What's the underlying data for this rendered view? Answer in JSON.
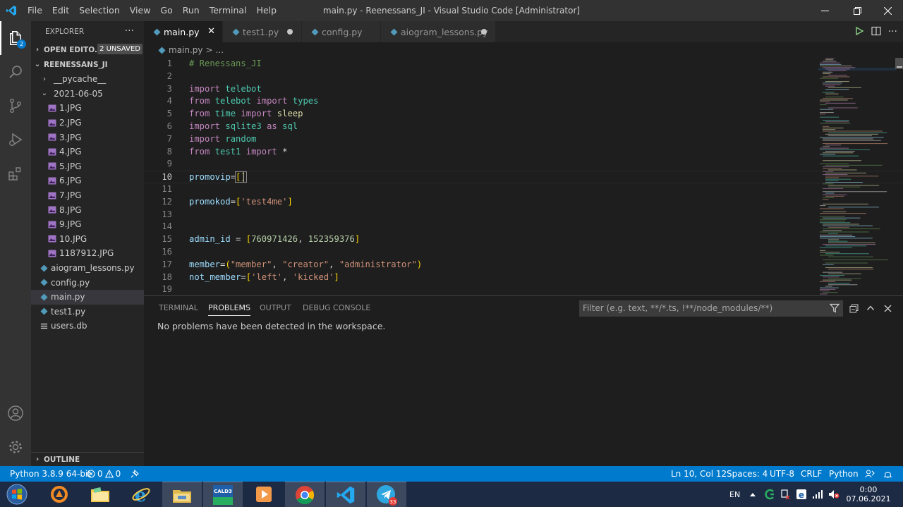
{
  "titlebar": {
    "menu": [
      "File",
      "Edit",
      "Selection",
      "View",
      "Go",
      "Run",
      "Terminal",
      "Help"
    ],
    "title": "main.py - Reenessans_JI - Visual Studio Code [Administrator]",
    "controls": [
      "minimize-icon",
      "restore-icon",
      "close-icon"
    ]
  },
  "activitybar": {
    "items": [
      "explorer-icon",
      "search-icon",
      "source-control-icon",
      "run-debug-icon",
      "extensions-icon"
    ],
    "explorer_badge": "2",
    "bottom": [
      "account-icon",
      "settings-gear-icon"
    ]
  },
  "sidebar": {
    "header": "EXPLORER",
    "more": "···",
    "open_editors": {
      "label": "OPEN EDITO...",
      "badge": "2 UNSAVED"
    },
    "folder": "REENESSANS_JI",
    "tree": [
      {
        "label": "__pycache__",
        "type": "folder",
        "expanded": false
      },
      {
        "label": "2021-06-05",
        "type": "folder",
        "expanded": true
      },
      {
        "label": "1.JPG",
        "type": "image"
      },
      {
        "label": "2.JPG",
        "type": "image"
      },
      {
        "label": "3.JPG",
        "type": "image"
      },
      {
        "label": "4.JPG",
        "type": "image"
      },
      {
        "label": "5.JPG",
        "type": "image"
      },
      {
        "label": "6.JPG",
        "type": "image"
      },
      {
        "label": "7.JPG",
        "type": "image"
      },
      {
        "label": "8.JPG",
        "type": "image"
      },
      {
        "label": "9.JPG",
        "type": "image"
      },
      {
        "label": "10.JPG",
        "type": "image"
      },
      {
        "label": "1187912.JPG",
        "type": "image"
      },
      {
        "label": "aiogram_lessons.py",
        "type": "python"
      },
      {
        "label": "config.py",
        "type": "python"
      },
      {
        "label": "main.py",
        "type": "python",
        "selected": true
      },
      {
        "label": "test1.py",
        "type": "python"
      },
      {
        "label": "users.db",
        "type": "db"
      }
    ],
    "outline": "OUTLINE"
  },
  "tabs": [
    {
      "label": "main.py",
      "active": true,
      "state": "close"
    },
    {
      "label": "test1.py",
      "active": false,
      "state": "dirty"
    },
    {
      "label": "config.py",
      "active": false,
      "state": "none"
    },
    {
      "label": "aiogram_lessons.py",
      "active": false,
      "state": "dirty"
    }
  ],
  "breadcrumb": {
    "file": "main.py",
    "sep": ">",
    "rest": "..."
  },
  "editor": {
    "current_line": 10,
    "lines": [
      {
        "n": "1",
        "tokens": [
          [
            "cm",
            "# Renessans_JI"
          ]
        ]
      },
      {
        "n": "2",
        "tokens": []
      },
      {
        "n": "3",
        "tokens": [
          [
            "kw",
            "import"
          ],
          [
            "t",
            " "
          ],
          [
            "mod",
            "telebot"
          ]
        ]
      },
      {
        "n": "4",
        "tokens": [
          [
            "kw",
            "from"
          ],
          [
            "t",
            " "
          ],
          [
            "mod",
            "telebot"
          ],
          [
            "t",
            " "
          ],
          [
            "kw",
            "import"
          ],
          [
            "t",
            " "
          ],
          [
            "mod",
            "types"
          ]
        ]
      },
      {
        "n": "5",
        "tokens": [
          [
            "kw",
            "from"
          ],
          [
            "t",
            " "
          ],
          [
            "mod",
            "time"
          ],
          [
            "t",
            " "
          ],
          [
            "kw",
            "import"
          ],
          [
            "t",
            " "
          ],
          [
            "fn",
            "sleep"
          ]
        ]
      },
      {
        "n": "6",
        "tokens": [
          [
            "kw",
            "import"
          ],
          [
            "t",
            " "
          ],
          [
            "mod",
            "sqlite3"
          ],
          [
            "t",
            " "
          ],
          [
            "kw",
            "as"
          ],
          [
            "t",
            " "
          ],
          [
            "mod",
            "sql"
          ]
        ]
      },
      {
        "n": "7",
        "tokens": [
          [
            "kw",
            "import"
          ],
          [
            "t",
            " "
          ],
          [
            "mod",
            "random"
          ]
        ]
      },
      {
        "n": "8",
        "tokens": [
          [
            "kw",
            "from"
          ],
          [
            "t",
            " "
          ],
          [
            "mod",
            "test1"
          ],
          [
            "t",
            " "
          ],
          [
            "kw",
            "import"
          ],
          [
            "t",
            " *"
          ]
        ]
      },
      {
        "n": "9",
        "tokens": []
      },
      {
        "n": "10",
        "tokens": [
          [
            "var",
            "promovip"
          ],
          [
            "t",
            "="
          ],
          [
            "hl",
            "[]"
          ]
        ]
      },
      {
        "n": "11",
        "tokens": []
      },
      {
        "n": "12",
        "tokens": [
          [
            "var",
            "promokod"
          ],
          [
            "t",
            "="
          ],
          [
            "br",
            "["
          ],
          [
            "str",
            "'test4me'"
          ],
          [
            "br",
            "]"
          ]
        ]
      },
      {
        "n": "13",
        "tokens": []
      },
      {
        "n": "14",
        "tokens": []
      },
      {
        "n": "15",
        "tokens": [
          [
            "var",
            "admin_id"
          ],
          [
            "t",
            " = "
          ],
          [
            "br",
            "["
          ],
          [
            "num",
            "760971426"
          ],
          [
            "t",
            ", "
          ],
          [
            "num",
            "152359376"
          ],
          [
            "br",
            "]"
          ]
        ]
      },
      {
        "n": "16",
        "tokens": []
      },
      {
        "n": "17",
        "tokens": [
          [
            "var",
            "member"
          ],
          [
            "t",
            "="
          ],
          [
            "br",
            "("
          ],
          [
            "str",
            "\"member\""
          ],
          [
            "t",
            ", "
          ],
          [
            "str",
            "\"creator\""
          ],
          [
            "t",
            ", "
          ],
          [
            "str",
            "\"administrator\""
          ],
          [
            "br",
            ")"
          ]
        ]
      },
      {
        "n": "18",
        "tokens": [
          [
            "var",
            "not_member"
          ],
          [
            "t",
            "="
          ],
          [
            "br",
            "["
          ],
          [
            "str",
            "'left'"
          ],
          [
            "t",
            ", "
          ],
          [
            "str",
            "'kicked'"
          ],
          [
            "br",
            "]"
          ]
        ]
      },
      {
        "n": "19",
        "tokens": []
      }
    ]
  },
  "panel": {
    "tabs": [
      "TERMINAL",
      "PROBLEMS",
      "OUTPUT",
      "DEBUG CONSOLE"
    ],
    "active_tab": "PROBLEMS",
    "filter_placeholder": "Filter (e.g. text, **/*.ts, !**/node_modules/**)",
    "message": "No problems have been detected in the workspace."
  },
  "statusbar": {
    "python": "Python 3.8.9 64-bit",
    "errors": "0",
    "warnings": "0",
    "position": "Ln 10, Col 12",
    "spaces": "Spaces: 4",
    "encoding": "UTF-8",
    "eol": "CRLF",
    "language": "Python"
  },
  "taskbar": {
    "apps": [
      "windows-start-icon",
      "avast-icon",
      "file-explorer-folder-icon",
      "internet-explorer-icon",
      "file-explorer-icon",
      "cald3-app-icon",
      "media-player-icon",
      "chrome-icon",
      "vscode-icon",
      "telegram-icon"
    ],
    "cald3_label": "CALD3",
    "telegram_badge": "33",
    "lang": "EN",
    "time": "0:00",
    "date": "07.06.2021"
  },
  "colors": {
    "accent": "#007acc",
    "editor_bg": "#1e1e1e",
    "sidebar_bg": "#252526",
    "activitybar_bg": "#333333",
    "titlebar_bg": "#323233",
    "taskbar_bg": "#1d2a44"
  }
}
